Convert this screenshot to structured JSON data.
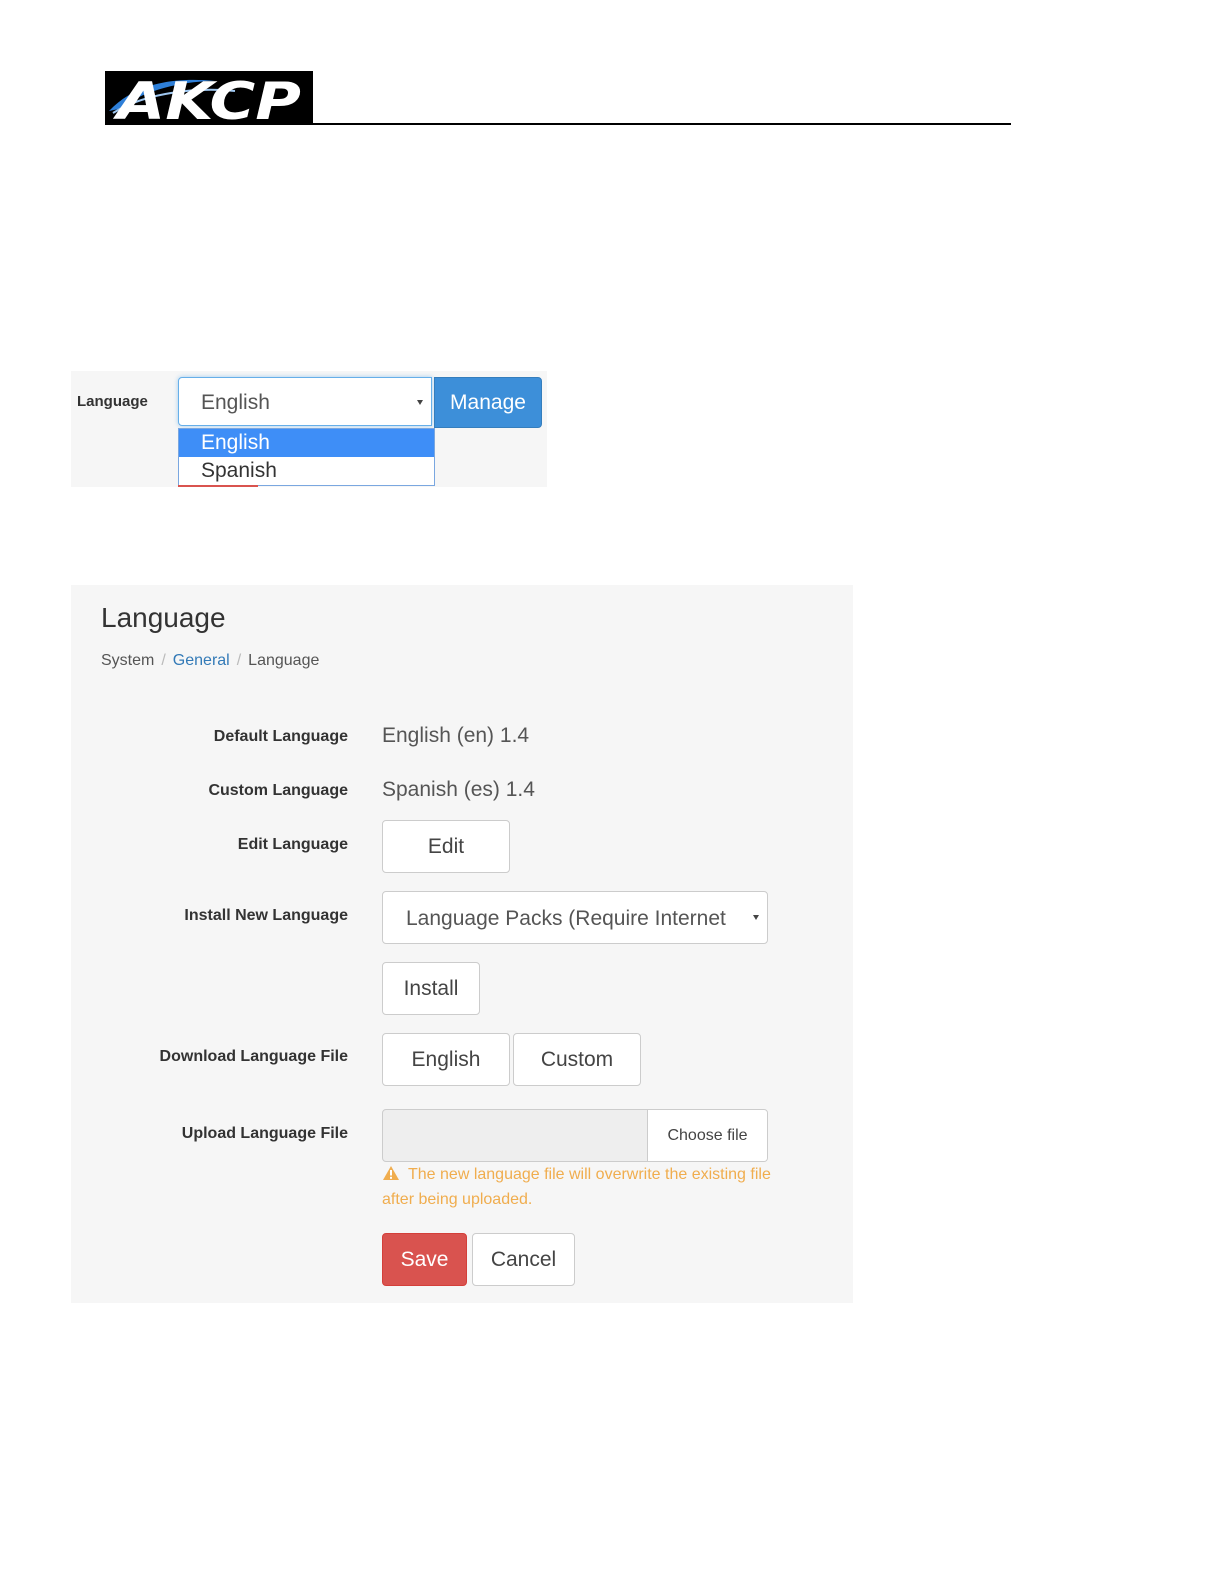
{
  "header": {
    "logo_text": "AKCP"
  },
  "dropdown_snippet": {
    "label": "Language",
    "selected_value": "English",
    "manage_label": "Manage",
    "options": [
      "English",
      "Spanish"
    ]
  },
  "language_page": {
    "title": "Language",
    "breadcrumb": {
      "system": "System",
      "general": "General",
      "current": "Language",
      "separator": "/"
    },
    "default_language": {
      "label": "Default Language",
      "value": "English (en) 1.4"
    },
    "custom_language": {
      "label": "Custom Language",
      "value": "Spanish (es) 1.4"
    },
    "edit_language": {
      "label": "Edit Language",
      "button": "Edit"
    },
    "install_new_language": {
      "label": "Install New Language",
      "selected_value": "Language Packs (Require Internet",
      "install_button": "Install"
    },
    "download_language_file": {
      "label": "Download Language File",
      "english_button": "English",
      "custom_button": "Custom"
    },
    "upload_language_file": {
      "label": "Upload Language File",
      "choose_file_button": "Choose file",
      "warning": "The new language file will overwrite the existing file after being uploaded."
    },
    "actions": {
      "save": "Save",
      "cancel": "Cancel"
    }
  },
  "colors": {
    "primary_blue": "#3d8fd9",
    "selected_option": "#3e8ef7",
    "danger_red": "#d9534f",
    "warning_orange": "#f0ad4e",
    "link_blue": "#337ab7"
  }
}
